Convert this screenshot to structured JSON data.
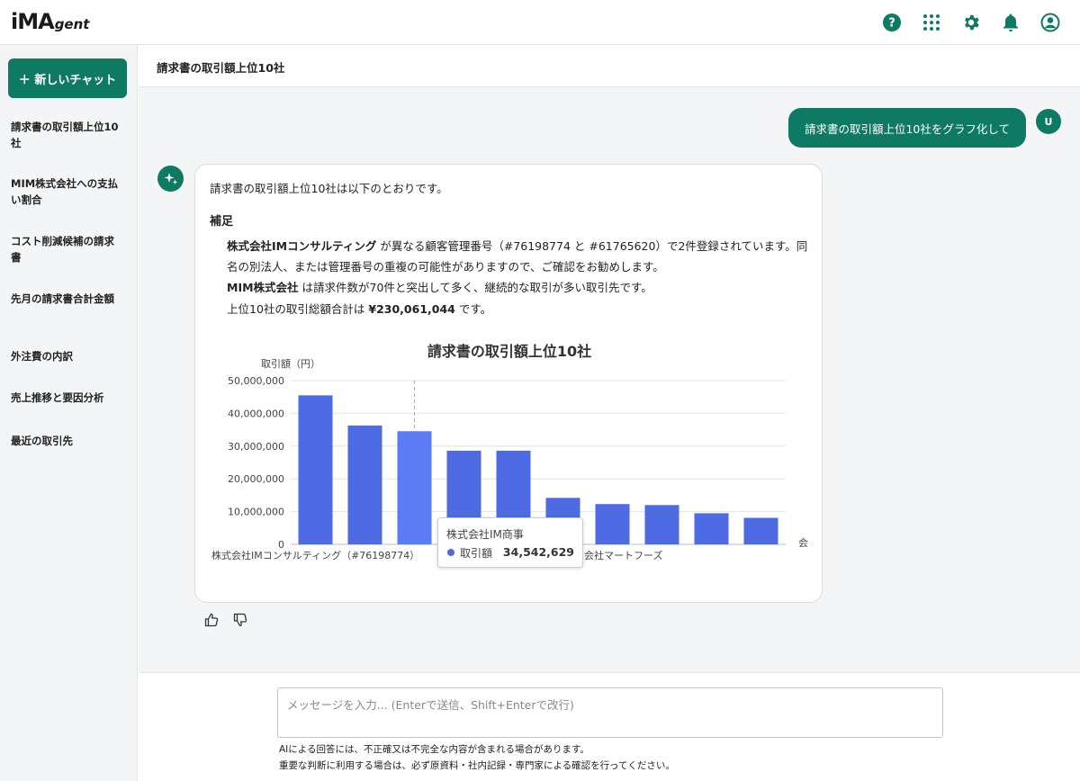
{
  "app": {
    "logo_big": "iMA",
    "logo_small": "gent"
  },
  "header": {
    "icons": [
      "help-icon",
      "apps-grid-icon",
      "settings-gear-icon",
      "notification-bell-icon",
      "account-icon"
    ]
  },
  "colors": {
    "brand": "#0f7a64",
    "bar": "#4e6be3",
    "bar_hover": "#5b7cf5"
  },
  "sidebar": {
    "new_chat_label": "＋ 新しいチャット",
    "items": [
      {
        "label": "請求書の取引額上位10社"
      },
      {
        "label": "MIM株式会社への支払い割合"
      },
      {
        "label": "コスト削減候補の請求書"
      },
      {
        "label": "先月の請求書合計金額"
      },
      {
        "label": "外注費の内訳"
      },
      {
        "label": "売上推移と要因分析"
      },
      {
        "label": "最近の取引先"
      }
    ]
  },
  "main": {
    "title": "請求書の取引額上位10社"
  },
  "chat": {
    "user_message": "請求書の取引額上位10社をグラフ化して",
    "user_avatar": "U",
    "ai": {
      "intro": "請求書の取引額上位10社は以下のとおりです。",
      "note_heading": "補足",
      "note1_bold": "株式会社IMコンサルティング",
      "note1_rest": " が異なる顧客管理番号（#76198774 と #61765620）で2件登録されています。同",
      "note1_line2": "名の別法人、または管理番号の重複の可能性がありますので、ご確認をお勧めします。",
      "note2_bold": "MIM株式会社",
      "note2_rest": " は請求件数が70件と突出して多く、継続的な取引が多い取引先です。",
      "note3_prefix": "上位10社の取引総額合計は ",
      "note3_bold": "¥230,061,044",
      "note3_suffix": " です。"
    }
  },
  "tooltip": {
    "company": "株式会社IM商事",
    "series": "取引額",
    "value": "34,542,629"
  },
  "chart_data": {
    "type": "bar",
    "title": "請求書の取引額上位10社",
    "ylabel": "取引額（円）",
    "ylim": [
      0,
      50000000
    ],
    "yticks": [
      "50,000,000",
      "40,000,000",
      "30,000,000",
      "20,000,000",
      "10,000,000",
      "0"
    ],
    "visible_xlabels": [
      "株式会社IMコンサルティング（#76198774）",
      "会社マートフーズ",
      "会"
    ],
    "series": [
      {
        "name": "取引額",
        "values": [
          45500000,
          36300000,
          34542629,
          28600000,
          28600000,
          14200000,
          12300000,
          12000000,
          9500000,
          8100000
        ]
      }
    ],
    "highlighted_index": 2,
    "grid": true
  },
  "input": {
    "placeholder": "メッセージを入力... (Enterで送信、Shift+Enterで改行)",
    "disclaimer1": "AIによる回答には、不正確又は不完全な内容が含まれる場合があります。",
    "disclaimer2": "重要な判断に利用する場合は、必ず原資料・社内記録・専門家による確認を行ってください。"
  }
}
